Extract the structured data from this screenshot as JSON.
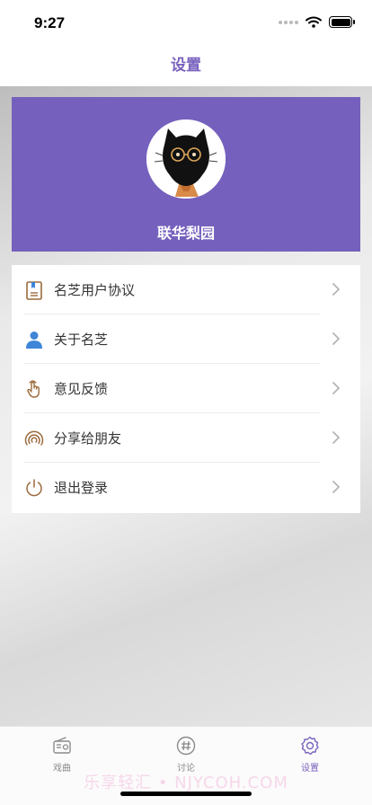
{
  "status": {
    "time": "9:27"
  },
  "nav": {
    "title": "设置"
  },
  "profile": {
    "name": "联华梨园"
  },
  "menu": {
    "items": [
      {
        "label": "名芝用户协议",
        "icon": "agreement-icon"
      },
      {
        "label": "关于名芝",
        "icon": "person-icon"
      },
      {
        "label": "意见反馈",
        "icon": "hand-tap-icon"
      },
      {
        "label": "分享给朋友",
        "icon": "share-signal-icon"
      },
      {
        "label": "退出登录",
        "icon": "power-icon"
      }
    ]
  },
  "tabs": [
    {
      "label": "戏曲",
      "icon": "radio-icon",
      "active": false
    },
    {
      "label": "讨论",
      "icon": "hashtag-icon",
      "active": false
    },
    {
      "label": "设置",
      "icon": "gear-icon",
      "active": true
    }
  ],
  "watermark": "乐享轻汇 • NJYCOH.COM",
  "colors": {
    "accent": "#7561bd",
    "icon_brown": "#9b6a3c",
    "person_blue": "#3f86d8"
  }
}
